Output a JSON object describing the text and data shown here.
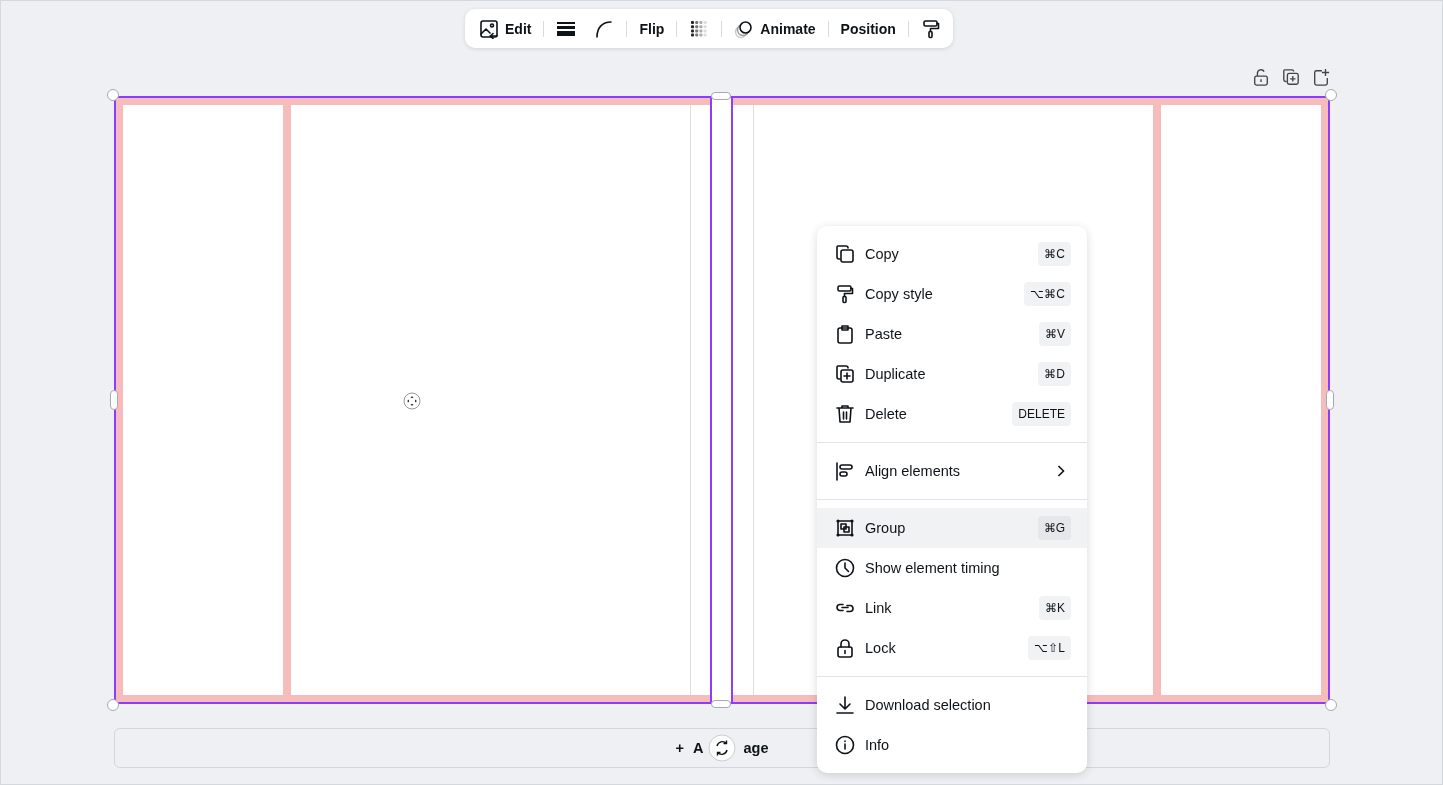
{
  "toolbar": {
    "groups": [
      [
        {
          "kind": "icon_label",
          "label": "Edit"
        }
      ],
      [
        {
          "kind": "icon"
        },
        {
          "kind": "icon"
        }
      ],
      [
        {
          "kind": "label",
          "label": "Flip"
        }
      ],
      [
        {
          "kind": "icon"
        }
      ],
      [
        {
          "kind": "icon_label",
          "label": "Animate"
        }
      ],
      [
        {
          "kind": "label",
          "label": "Position"
        }
      ],
      [
        {
          "kind": "icon"
        }
      ]
    ]
  },
  "canvas": {
    "selected": true
  },
  "context_menu": {
    "sections": [
      [
        {
          "label": "Copy",
          "shortcut": "⌘C",
          "highlighted": false
        },
        {
          "label": "Copy style",
          "shortcut": "⌥⌘C",
          "highlighted": false
        },
        {
          "label": "Paste",
          "shortcut": "⌘V",
          "highlighted": false
        },
        {
          "label": "Duplicate",
          "shortcut": "⌘D",
          "highlighted": false
        },
        {
          "label": "Delete",
          "shortcut": "DELETE",
          "highlighted": false
        }
      ],
      [
        {
          "label": "Align elements",
          "submenu": true,
          "highlighted": false
        }
      ],
      [
        {
          "label": "Group",
          "shortcut": "⌘G",
          "highlighted": true
        },
        {
          "label": "Show element timing",
          "highlighted": false
        },
        {
          "label": "Link",
          "shortcut": "⌘K",
          "highlighted": false
        },
        {
          "label": "Lock",
          "shortcut": "⌥⇧L",
          "highlighted": false
        }
      ],
      [
        {
          "label": "Download selection",
          "highlighted": false
        },
        {
          "label": "Info",
          "highlighted": false
        }
      ]
    ]
  },
  "add_page": {
    "plus": "+",
    "label_start": "A",
    "label_end": "age"
  }
}
